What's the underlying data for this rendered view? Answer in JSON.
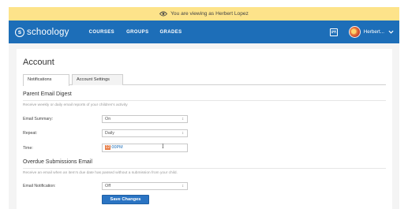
{
  "banner": {
    "text": "You are viewing as Herbert Lopez"
  },
  "nav": {
    "logo_mark": "s",
    "logo_text": "schoology",
    "links": [
      "COURSES",
      "GROUPS",
      "GRADES"
    ],
    "user_name": "Herbert..."
  },
  "page": {
    "title": "Account",
    "tabs": [
      "Notifications",
      "Account Settings"
    ],
    "active_tab": "Notifications"
  },
  "digest": {
    "title": "Parent Email Digest",
    "description": "Receive weekly or daily email reports of your children's activity",
    "fields": [
      {
        "label": "Email Summary:",
        "value": "On"
      },
      {
        "label": "Repeat:",
        "value": "Daily"
      },
      {
        "label": "Time:",
        "value_highlight": "12",
        "value_rest": ":00PM"
      }
    ]
  },
  "overdue": {
    "title": "Overdue Submissions Email",
    "description": "Receive an email when an item's due date has passed without a submission from your child.",
    "field": {
      "label": "Email Notification:",
      "value": "Off"
    }
  },
  "save_label": "Save Changes",
  "colors": {
    "banner_bg": "#fde38a",
    "nav_bg": "#1d6eb8",
    "button_bg": "#2a74c3",
    "time_highlight": "#e87a42"
  },
  "icons": [
    "eye-icon",
    "logo-icon",
    "calendar-icon",
    "avatar",
    "chevron-down-icon",
    "text-cursor-icon"
  ]
}
